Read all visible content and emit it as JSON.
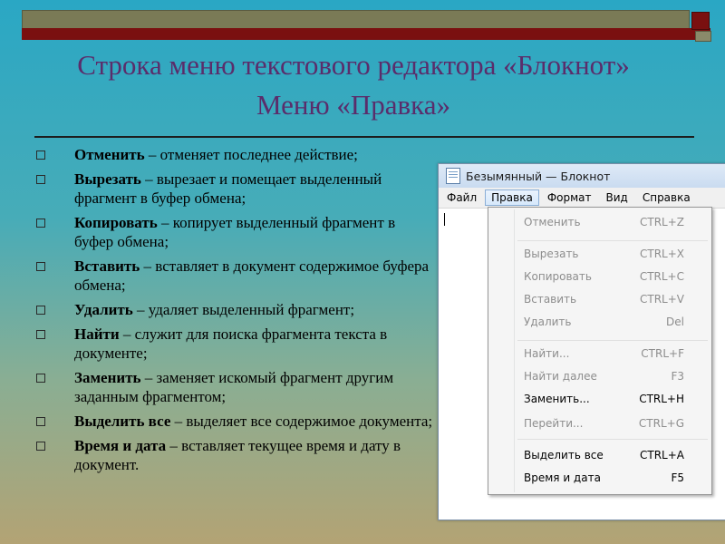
{
  "slide": {
    "title_line1": "Строка меню текстового редактора «Блокнот»",
    "title_line2": "Меню «Правка»"
  },
  "bullets": [
    {
      "term": "Отменить",
      "desc": " – отменяет последнее действие;"
    },
    {
      "term": "Вырезать",
      "desc": " – вырезает и помещает выделенный фрагмент в буфер обмена;"
    },
    {
      "term": "Копировать",
      "desc": " – копирует выделенный фрагмент в буфер обмена;"
    },
    {
      "term": "Вставить",
      "desc": " – вставляет в документ содержимое буфера обмена;"
    },
    {
      "term": "Удалить",
      "desc": " – удаляет выделенный фрагмент;"
    },
    {
      "term": "Найти",
      "desc": " – служит для поиска фрагмента текста в документе;"
    },
    {
      "term": "Заменить",
      "desc": " – заменяет искомый фрагмент другим заданным фрагментом;"
    },
    {
      "term": "Выделить все",
      "desc": " – выделяет все содержимое документа;"
    },
    {
      "term": "Время и дата",
      "desc": " – вставляет текущее время и дату в документ."
    }
  ],
  "notepad": {
    "window_title": "Безымянный — Блокнот",
    "menu": [
      "Файл",
      "Правка",
      "Формат",
      "Вид",
      "Справка"
    ],
    "dropdown": [
      {
        "label": "Отменить",
        "shortcut": "CTRL+Z",
        "enabled": false
      },
      {
        "label": "Вырезать",
        "shortcut": "CTRL+X",
        "enabled": false
      },
      {
        "label": "Копировать",
        "shortcut": "CTRL+C",
        "enabled": false
      },
      {
        "label": "Вставить",
        "shortcut": "CTRL+V",
        "enabled": false
      },
      {
        "label": "Удалить",
        "shortcut": "Del",
        "enabled": false
      },
      {
        "label": "Найти...",
        "shortcut": "CTRL+F",
        "enabled": false
      },
      {
        "label": "Найти далее",
        "shortcut": "F3",
        "enabled": false
      },
      {
        "label": "Заменить...",
        "shortcut": "CTRL+H",
        "enabled": true
      },
      {
        "label": "Перейти...",
        "shortcut": "CTRL+G",
        "enabled": false
      },
      {
        "label": "Выделить все",
        "shortcut": "CTRL+A",
        "enabled": true
      },
      {
        "label": "Время и дата",
        "shortcut": "F5",
        "enabled": true
      }
    ]
  },
  "colors": {
    "title": "#5a2d6b",
    "accent_red": "#7a1010"
  }
}
